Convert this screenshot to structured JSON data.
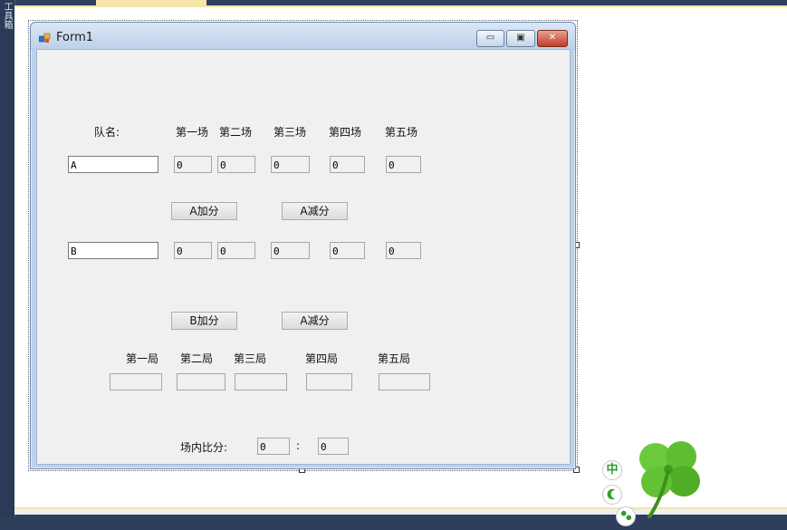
{
  "side_panel": {
    "label": "工具箱"
  },
  "window": {
    "title": "Form1",
    "controls": {
      "minimize": "▭",
      "maximize": "▣",
      "close": "✕"
    }
  },
  "team_header": {
    "label": "队名:",
    "games": [
      "第一场",
      "第二场",
      "第三场",
      "第四场",
      "第五场"
    ]
  },
  "team_a": {
    "name": "A",
    "scores": [
      "0",
      "0",
      "0",
      "0",
      "0"
    ]
  },
  "team_b": {
    "name": "B",
    "scores": [
      "0",
      "0",
      "0",
      "0",
      "0"
    ]
  },
  "buttons": {
    "a_add": "A加分",
    "a_sub": "A减分",
    "b_add": "B加分",
    "b_sub": "A减分"
  },
  "sets": {
    "labels": [
      "第一局",
      "第二局",
      "第三局",
      "第四局",
      "第五局"
    ],
    "values": [
      "",
      "",
      "",
      "",
      ""
    ]
  },
  "match_score": {
    "label": "场内比分:",
    "left": "0",
    "separator": ":",
    "right": "0"
  },
  "ime": {
    "mode": "中"
  },
  "colors": {
    "title_bar": "#bcd0e8",
    "client_bg": "#f0f0f0",
    "close_button": "#c33a27",
    "accent_gold": "#f3e3ad"
  }
}
